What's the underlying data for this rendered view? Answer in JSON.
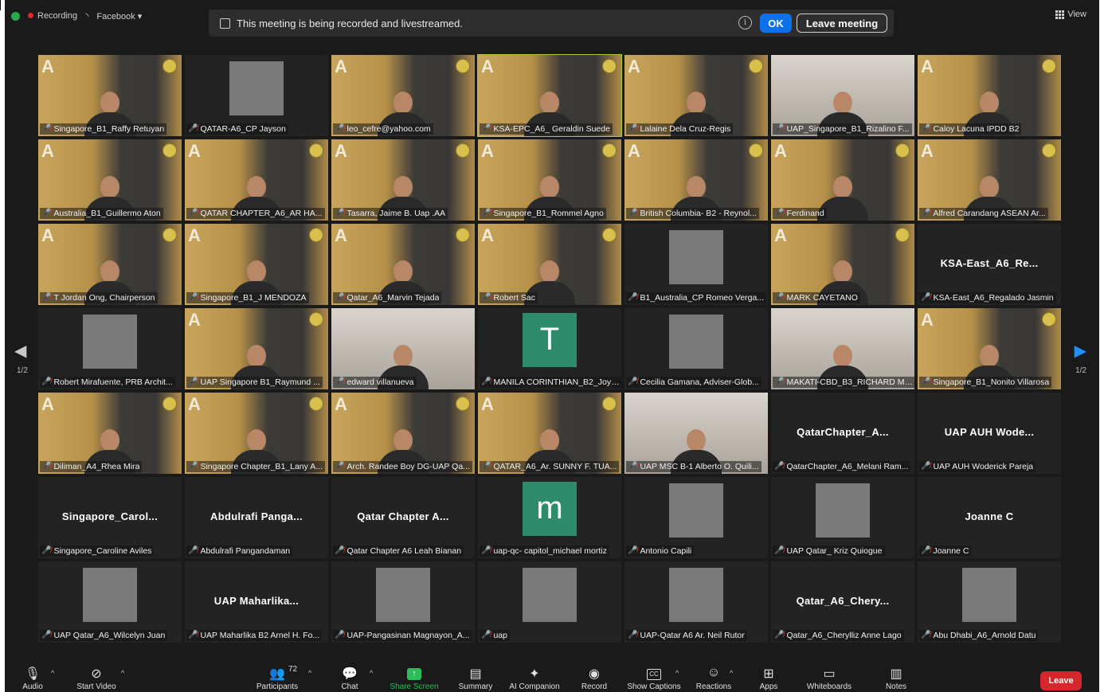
{
  "status": {
    "recording_label": "Recording",
    "stream_label": "Facebook",
    "view_label": "View"
  },
  "banner": {
    "message": "This meeting is being recorded and livestreamed.",
    "ok_label": "OK",
    "leave_label": "Leave meeting"
  },
  "pagination": {
    "left": "1/2",
    "right": "1/2"
  },
  "tiles": [
    {
      "name": "Singapore_B1_Raffy Retuyan",
      "bg": "wall"
    },
    {
      "name": "QATAR-A6_CP Jayson",
      "bg": "dark-pic"
    },
    {
      "name": "leo_cefre@yahoo.com",
      "bg": "wall"
    },
    {
      "name": "KSA-EPC_A6_ Geraldin Suede",
      "bg": "wall",
      "active": true
    },
    {
      "name": "Lalaine Dela Cruz-Regis",
      "bg": "wall"
    },
    {
      "name": "UAP_Singapore_B1_Rizalino F...",
      "bg": "room"
    },
    {
      "name": "Caloy Lacuna IPDD B2",
      "bg": "wall"
    },
    {
      "name": "Australia_B1_Guillermo Aton",
      "bg": "wall"
    },
    {
      "name": "QATAR CHAPTER_A6_AR HA...",
      "bg": "wall"
    },
    {
      "name": "Tasarra, Jaime B. Uap .AA",
      "bg": "wall"
    },
    {
      "name": "Singapore_B1_Rommel Agno",
      "bg": "wall"
    },
    {
      "name": "British Columbia- B2 - Reynol...",
      "bg": "wall"
    },
    {
      "name": "Ferdinand",
      "bg": "wall"
    },
    {
      "name": "Alfred Carandang ASEAN Ar...",
      "bg": "wall"
    },
    {
      "name": "T Jordan Ong, Chairperson",
      "bg": "wall"
    },
    {
      "name": "Singapore_B1_J MENDOZA",
      "bg": "wall"
    },
    {
      "name": "Qatar_A6_Marvin Tejada",
      "bg": "wall"
    },
    {
      "name": "Robert Sac",
      "bg": "wall"
    },
    {
      "name": "B1_Australia_CP Romeo Verga...",
      "bg": "dark-pic"
    },
    {
      "name": "MARK CAYETANO",
      "bg": "wall"
    },
    {
      "name": "KSA-East_A6_Regalado Jasmin",
      "bg": "name",
      "bigname": "KSA-East_A6_Re..."
    },
    {
      "name": "Robert Mirafuente, PRB Archit...",
      "bg": "dark-pic"
    },
    {
      "name": "UAP Singapore B1_Raymund ...",
      "bg": "wall"
    },
    {
      "name": "edward villanueva",
      "bg": "room"
    },
    {
      "name": "MANILA CORINTHIAN_B2_Joy ...",
      "bg": "avatar",
      "letter": "T"
    },
    {
      "name": "Cecilia Gamana, Adviser-Glob...",
      "bg": "dark-pic"
    },
    {
      "name": "MAKATI-CBD_B3_RICHARD MI...",
      "bg": "room"
    },
    {
      "name": "Singapore_B1_Nonito Villarosa",
      "bg": "wall"
    },
    {
      "name": "Diliman_A4_Rhea Mira",
      "bg": "wall"
    },
    {
      "name": "Singapore Chapter_B1_Lany A...",
      "bg": "wall"
    },
    {
      "name": "Arch. Randee Boy DG-UAP Qa...",
      "bg": "wall"
    },
    {
      "name": "QATAR_A6_Ar. SUNNY F. TUA...",
      "bg": "wall"
    },
    {
      "name": "UAP MSC B-1 Alberto O. Quili...",
      "bg": "room"
    },
    {
      "name": "QatarChapter_A6_Melani Ram...",
      "bg": "name",
      "bigname": "QatarChapter_A..."
    },
    {
      "name": "UAP AUH Woderick Pareja",
      "bg": "name",
      "bigname": "UAP AUH Wode..."
    },
    {
      "name": "Singapore_Caroline Aviles",
      "bg": "name",
      "bigname": "Singapore_Carol..."
    },
    {
      "name": "Abdulrafi Pangandaman",
      "bg": "name",
      "bigname": "Abdulrafi  Panga..."
    },
    {
      "name": "Qatar Chapter A6 Leah Bianan",
      "bg": "name",
      "bigname": "Qatar Chapter  A..."
    },
    {
      "name": "uap-qc- capitol_michael mortiz",
      "bg": "avatar",
      "letter": "m"
    },
    {
      "name": "Antonio Capili",
      "bg": "dark-pic"
    },
    {
      "name": "UAP Qatar_ Kriz Quiogue",
      "bg": "dark-pic"
    },
    {
      "name": "Joanne C",
      "bg": "name",
      "bigname": "Joanne C"
    },
    {
      "name": "UAP Qatar_A6_Wilcelyn Juan",
      "bg": "dark-pic"
    },
    {
      "name": "UAP Maharlika B2 Arnel H. Fo...",
      "bg": "name",
      "bigname": "UAP  Maharlika..."
    },
    {
      "name": "UAP-Pangasinan Magnayon_A...",
      "bg": "dark-pic"
    },
    {
      "name": "uap",
      "bg": "dark-pic"
    },
    {
      "name": "UAP-Qatar A6 Ar. Neil Rutor",
      "bg": "dark-pic"
    },
    {
      "name": "Qatar_A6_Cherylliz Anne Lago",
      "bg": "name",
      "bigname": "Qatar_A6_Chery..."
    },
    {
      "name": "Abu Dhabi_A6_Arnold Datu",
      "bg": "dark-pic"
    }
  ],
  "toolbar": {
    "audio": "Audio",
    "video": "Start Video",
    "participants": "Participants",
    "participants_count": "72",
    "chat": "Chat",
    "share": "Share Screen",
    "summary": "Summary",
    "ai": "AI Companion",
    "record": "Record",
    "captions": "Show Captions",
    "reactions": "Reactions",
    "apps": "Apps",
    "whiteboards": "Whiteboards",
    "notes": "Notes",
    "leave": "Leave"
  },
  "colors": {
    "accent_blue": "#0e71eb",
    "leave_red": "#d6262b",
    "share_green": "#2bbd59",
    "active_outline": "#a9c742"
  }
}
